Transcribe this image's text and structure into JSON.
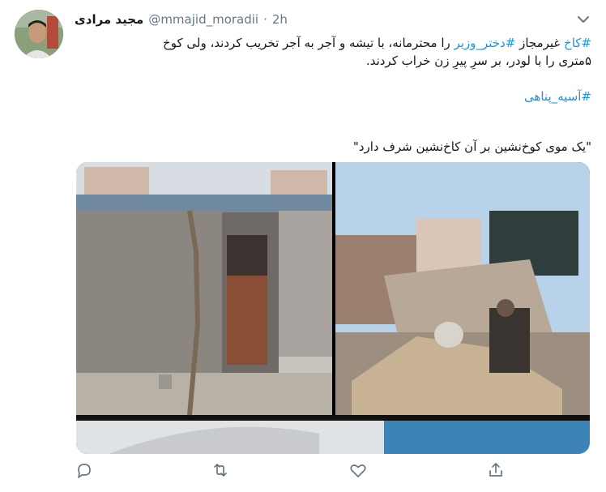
{
  "tweet": {
    "author_name": "مجید مرادی",
    "handle": "@mmajid_moradii",
    "separator": "·",
    "time": "2h",
    "line1_hashtag1": "#کاخ",
    "line1_text1": " غیرمجاز ",
    "line1_hashtag2": "#دختر_وزیر",
    "line1_text2": " را محترمانه، با تیشه و آجر به آجر تخریب کردند، ولی کوخ",
    "line2": "۵متری را با لودر، بر سرِ پیرِ زن خراب کردند.",
    "hashtag_line": "#آسیه_پناهی",
    "quote_line": "\"یک موی کوخ‌نشین بر آن کاخ‌نشین شرف دارد\"",
    "image_alt": "Tweet photo collage"
  },
  "actions": {
    "reply_icon": "reply-icon",
    "retweet_icon": "retweet-icon",
    "like_icon": "heart-icon",
    "share_icon": "share-icon"
  },
  "colors": {
    "link": "#1b95e0",
    "muted": "#657786",
    "text": "#14171a"
  }
}
